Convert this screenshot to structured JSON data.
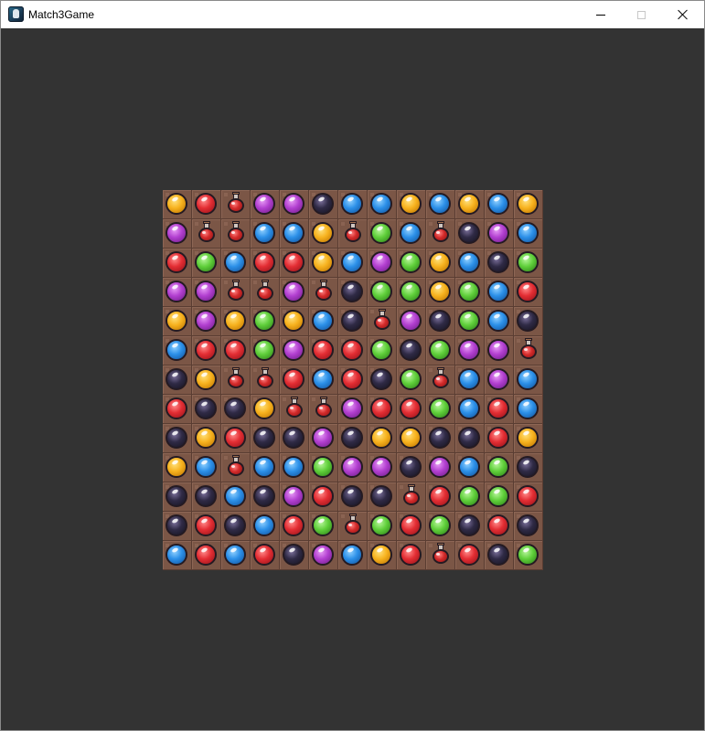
{
  "window": {
    "title": "Match3Game"
  },
  "controls": {
    "minimize_icon": "minimize-icon",
    "maximize_icon": "maximize-icon",
    "close_icon": "close-icon"
  },
  "palette": {
    "yellow": "#f7b21e",
    "red": "#e32d33",
    "purple": "#b23fd0",
    "blue": "#2b8fe8",
    "green": "#5fcf3a",
    "dark": "#2f2a45",
    "potion": "#d32a2a",
    "tile": "#7b5646",
    "background": "#333333"
  },
  "board": {
    "rows": [
      [
        "yellow",
        "red",
        "potion",
        "purple",
        "purple",
        "dark",
        "blue",
        "blue",
        "yellow",
        "blue",
        "yellow",
        "blue",
        "yellow"
      ],
      [
        "purple",
        "potion",
        "potion",
        "blue",
        "blue",
        "yellow",
        "potion",
        "green",
        "blue",
        "potion",
        "dark",
        "purple",
        "blue"
      ],
      [
        "red",
        "green",
        "blue",
        "red",
        "red",
        "yellow",
        "blue",
        "purple",
        "green",
        "yellow",
        "blue",
        "dark",
        "green"
      ],
      [
        "purple",
        "purple",
        "potion",
        "potion",
        "purple",
        "potion",
        "dark",
        "green",
        "green",
        "yellow",
        "green",
        "blue",
        "red"
      ],
      [
        "yellow",
        "purple",
        "yellow",
        "green",
        "yellow",
        "blue",
        "dark",
        "potion",
        "purple",
        "dark",
        "green",
        "blue",
        "dark"
      ],
      [
        "blue",
        "red",
        "red",
        "green",
        "purple",
        "red",
        "red",
        "green",
        "dark",
        "green",
        "purple",
        "purple",
        "potion"
      ],
      [
        "dark",
        "yellow",
        "potion",
        "potion",
        "red",
        "blue",
        "red",
        "dark",
        "green",
        "potion",
        "blue",
        "purple",
        "blue"
      ],
      [
        "red",
        "dark",
        "dark",
        "yellow",
        "potion",
        "potion",
        "purple",
        "red",
        "red",
        "green",
        "blue",
        "red",
        "blue"
      ],
      [
        "dark",
        "yellow",
        "red",
        "dark",
        "dark",
        "purple",
        "dark",
        "yellow",
        "yellow",
        "dark",
        "dark",
        "red",
        "yellow"
      ],
      [
        "yellow",
        "blue",
        "potion",
        "blue",
        "blue",
        "green",
        "purple",
        "purple",
        "dark",
        "purple",
        "blue",
        "green",
        "dark"
      ],
      [
        "dark",
        "dark",
        "blue",
        "dark",
        "purple",
        "red",
        "dark",
        "dark",
        "potion",
        "red",
        "green",
        "green",
        "red"
      ],
      [
        "dark",
        "red",
        "dark",
        "blue",
        "red",
        "green",
        "potion",
        "green",
        "red",
        "green",
        "dark",
        "red",
        "dark"
      ],
      [
        "blue",
        "red",
        "blue",
        "red",
        "dark",
        "purple",
        "blue",
        "yellow",
        "red",
        "potion",
        "red",
        "dark",
        "green"
      ]
    ]
  }
}
